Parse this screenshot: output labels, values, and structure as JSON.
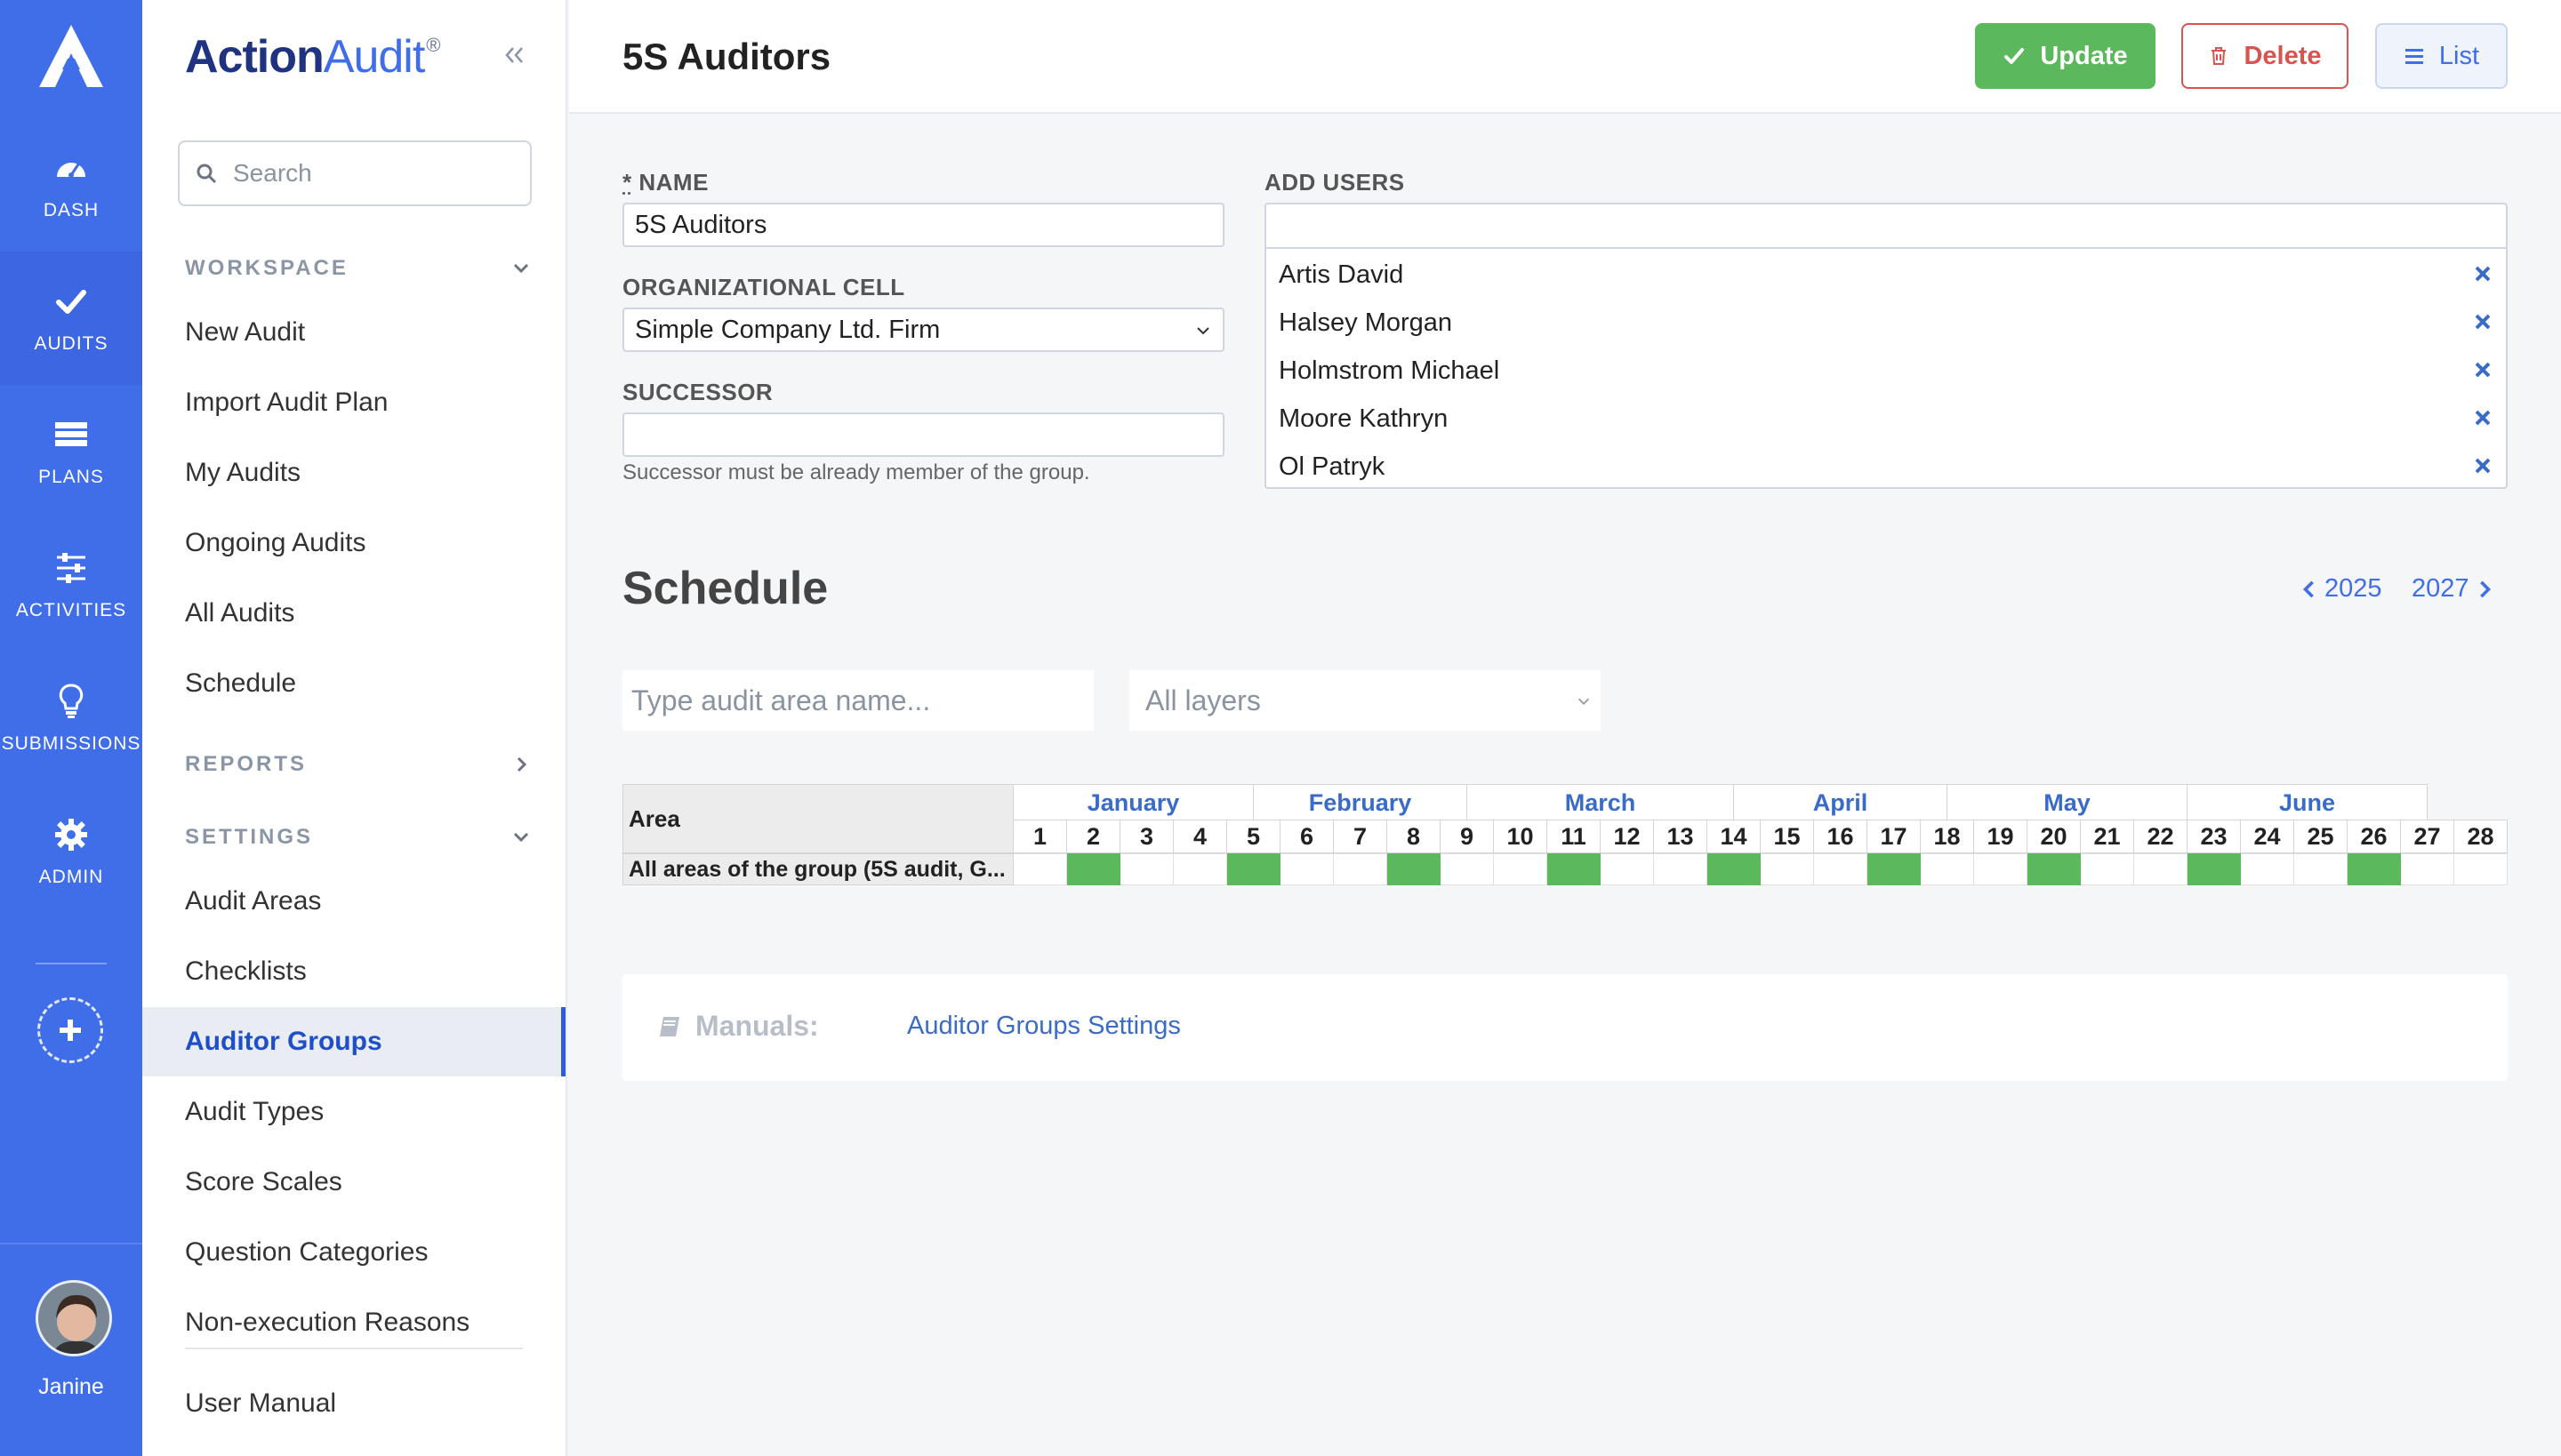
{
  "rail": {
    "items": [
      {
        "label": "DASH",
        "icon": "dashboard-icon"
      },
      {
        "label": "AUDITS",
        "icon": "check-icon"
      },
      {
        "label": "PLANS",
        "icon": "plans-icon"
      },
      {
        "label": "ACTIVITIES",
        "icon": "sliders-icon"
      },
      {
        "label": "SUBMISSIONS",
        "icon": "lightbulb-icon"
      },
      {
        "label": "ADMIN",
        "icon": "gear-icon"
      }
    ],
    "active": "AUDITS",
    "user_name": "Janine"
  },
  "sidebar": {
    "brand_action": "Action",
    "brand_audit": "Audit",
    "brand_mark": "®",
    "search_placeholder": "Search",
    "sections": {
      "workspace": "WORKSPACE",
      "reports": "REPORTS",
      "settings": "SETTINGS"
    },
    "workspace_items": [
      "New Audit",
      "Import Audit Plan",
      "My Audits",
      "Ongoing Audits",
      "All Audits",
      "Schedule"
    ],
    "settings_items": [
      "Audit Areas",
      "Checklists",
      "Auditor Groups",
      "Audit Types",
      "Score Scales",
      "Question Categories",
      "Non-execution Reasons"
    ],
    "active_item": "Auditor Groups",
    "footer_item": "User Manual"
  },
  "header": {
    "title": "5S Auditors",
    "update_label": "Update",
    "delete_label": "Delete",
    "list_label": "List"
  },
  "form": {
    "name_required": "*",
    "name_label": "NAME",
    "name_value": "5S Auditors",
    "org_cell_label": "ORGANIZATIONAL CELL",
    "org_cell_value": "Simple Company Ltd. Firm",
    "successor_label": "SUCCESSOR",
    "successor_value": "",
    "successor_help": "Successor must be already member of the group.",
    "add_users_label": "ADD USERS",
    "users": [
      "Artis David",
      "Halsey Morgan",
      "Holmstrom Michael",
      "Moore Kathryn",
      "Ol Patryk"
    ]
  },
  "schedule": {
    "title": "Schedule",
    "prev_year": "2025",
    "next_year": "2027",
    "area_filter_placeholder": "Type audit area name...",
    "layers_value": "All layers",
    "area_header": "Area",
    "area_row": "All areas of the group (5S audit, G...",
    "months": [
      {
        "name": "January",
        "weeks": 4.5
      },
      {
        "name": "February",
        "weeks": 4
      },
      {
        "name": "March",
        "weeks": 5
      },
      {
        "name": "April",
        "weeks": 4
      },
      {
        "name": "May",
        "weeks": 4.5
      },
      {
        "name": "June",
        "weeks": 4.5
      }
    ],
    "weeks": [
      "1",
      "2",
      "3",
      "4",
      "5",
      "6",
      "7",
      "8",
      "9",
      "10",
      "11",
      "12",
      "13",
      "14",
      "15",
      "16",
      "17",
      "18",
      "19",
      "20",
      "21",
      "22",
      "23",
      "24",
      "25",
      "26",
      "27",
      "28"
    ],
    "scheduled_weeks": [
      2,
      5,
      8,
      11,
      14,
      17,
      20,
      23,
      26
    ],
    "colors": {
      "scheduled": "#5cb85c",
      "month_text": "#3a6cc7"
    }
  },
  "manuals": {
    "label": "Manuals:",
    "link": "Auditor Groups Settings"
  }
}
